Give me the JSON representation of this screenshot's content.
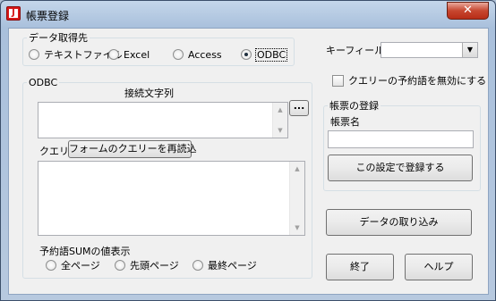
{
  "window": {
    "title": "帳票登録",
    "icon_letter": "J",
    "close": "✕"
  },
  "data_source": {
    "legend": "データ取得先",
    "options": [
      "テキストファイル",
      "Excel",
      "Access",
      "ODBC"
    ],
    "selected": "ODBC"
  },
  "key_field": {
    "label": "キーフィールド",
    "value": ""
  },
  "reserved_words_checkbox": {
    "label": "クエリーの予約語を無効にする",
    "checked": false
  },
  "odbc": {
    "legend": "ODBC",
    "connection_label": "接続文字列",
    "connection_value": "",
    "browse_label": "...",
    "query_label": "クエリー",
    "reload_label": "フォームのクエリーを再読込",
    "query_value": ""
  },
  "reserved_sum": {
    "label": "予約語SUMの値表示",
    "options": [
      "全ページ",
      "先頭ページ",
      "最終ページ"
    ],
    "selected": null
  },
  "registration": {
    "legend": "帳票の登録",
    "name_label": "帳票名",
    "name_value": "",
    "register_label": "この設定で登録する"
  },
  "buttons": {
    "import": "データの取り込み",
    "exit": "終了",
    "help": "ヘルプ"
  }
}
